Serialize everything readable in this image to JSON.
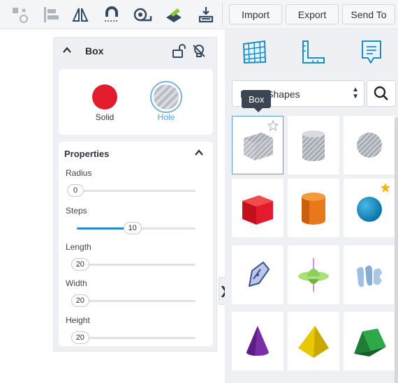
{
  "toolbar": {
    "tools": [
      {
        "icon": "group-icon"
      },
      {
        "icon": "align-icon"
      },
      {
        "icon": "mirror-icon"
      },
      {
        "icon": "magnet-icon"
      },
      {
        "icon": "ruler-icon"
      },
      {
        "icon": "workplane-icon"
      },
      {
        "icon": "drop-icon"
      }
    ],
    "import_label": "Import",
    "export_label": "Export",
    "send_to_label": "Send To"
  },
  "inspector": {
    "title": "Box",
    "solid_label": "Solid",
    "hole_label": "Hole",
    "properties_title": "Properties",
    "properties": [
      {
        "label": "Radius",
        "value": "0",
        "level": 0
      },
      {
        "label": "Steps",
        "value": "10",
        "level": 0.45
      },
      {
        "label": "Length",
        "value": "20",
        "level": 0.01
      },
      {
        "label": "Width",
        "value": "20",
        "level": 0.01
      },
      {
        "label": "Height",
        "value": "20",
        "level": 0.01
      }
    ],
    "colors": {
      "solid": "#e21c2c",
      "hole_border": "#7ab2e0",
      "slider": "#2f87c8"
    }
  },
  "panel_toggle": "❯",
  "library": {
    "category": "Basic Shapes",
    "tooltip": "Box",
    "shapes": [
      {
        "name": "box",
        "selected": true,
        "favorite": false
      },
      {
        "name": "cylinder-hole",
        "selected": false,
        "favorite": null
      },
      {
        "name": "sphere-hole",
        "selected": false,
        "favorite": null
      },
      {
        "name": "box-red",
        "selected": false,
        "favorite": null
      },
      {
        "name": "cylinder-orange",
        "selected": false,
        "favorite": null
      },
      {
        "name": "sphere-blue",
        "selected": false,
        "favorite": true
      },
      {
        "name": "scribble",
        "selected": false,
        "favorite": null
      },
      {
        "name": "spinner",
        "selected": false,
        "favorite": null
      },
      {
        "name": "text-shape",
        "selected": false,
        "favorite": null
      },
      {
        "name": "cone-purple",
        "selected": false,
        "favorite": null
      },
      {
        "name": "pyramid-yellow",
        "selected": false,
        "favorite": null
      },
      {
        "name": "roof-green",
        "selected": false,
        "favorite": null
      }
    ]
  }
}
